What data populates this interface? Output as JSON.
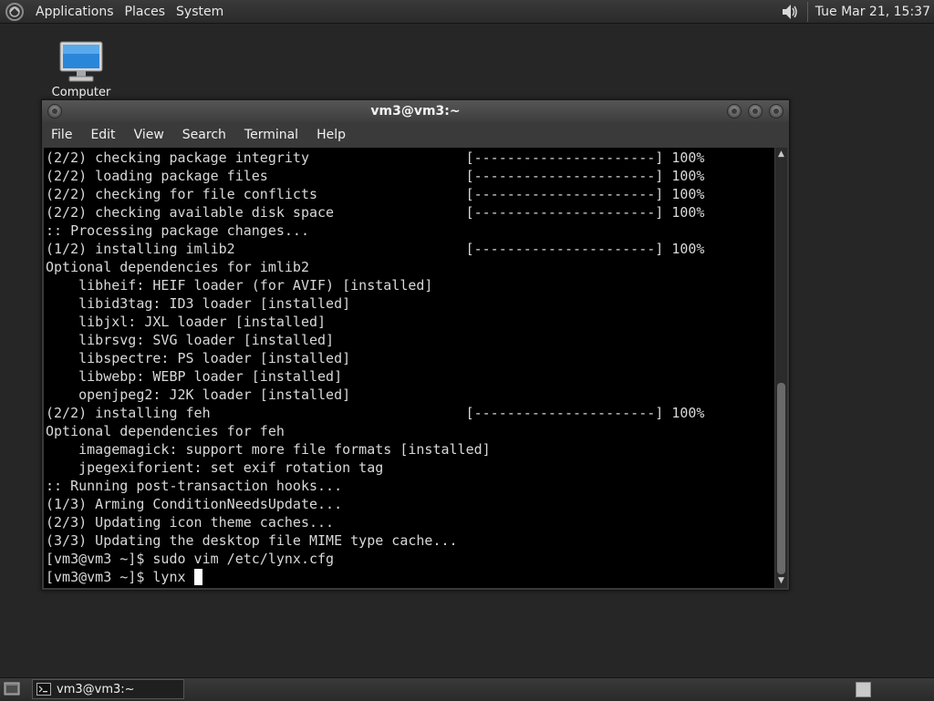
{
  "top_panel": {
    "menus": [
      "Applications",
      "Places",
      "System"
    ],
    "clock": "Tue Mar 21, 15:37"
  },
  "desktop": {
    "icons": [
      {
        "label": "Computer",
        "icon": "computer-icon"
      }
    ]
  },
  "terminal": {
    "title": "vm3@vm3:~",
    "menu": [
      "File",
      "Edit",
      "View",
      "Search",
      "Terminal",
      "Help"
    ],
    "lines": [
      "(2/2) checking package integrity                   [----------------------] 100%",
      "(2/2) loading package files                        [----------------------] 100%",
      "(2/2) checking for file conflicts                  [----------------------] 100%",
      "(2/2) checking available disk space                [----------------------] 100%",
      ":: Processing package changes...",
      "(1/2) installing imlib2                            [----------------------] 100%",
      "Optional dependencies for imlib2",
      "    libheif: HEIF loader (for AVIF) [installed]",
      "    libid3tag: ID3 loader [installed]",
      "    libjxl: JXL loader [installed]",
      "    librsvg: SVG loader [installed]",
      "    libspectre: PS loader [installed]",
      "    libwebp: WEBP loader [installed]",
      "    openjpeg2: J2K loader [installed]",
      "(2/2) installing feh                               [----------------------] 100%",
      "Optional dependencies for feh",
      "    imagemagick: support more file formats [installed]",
      "    jpegexiforient: set exif rotation tag",
      ":: Running post-transaction hooks...",
      "(1/3) Arming ConditionNeedsUpdate...",
      "(2/3) Updating icon theme caches...",
      "(3/3) Updating the desktop file MIME type cache...",
      "[vm3@vm3 ~]$ sudo vim /etc/lynx.cfg"
    ],
    "prompt": "[vm3@vm3 ~]$ lynx "
  },
  "bottom_panel": {
    "tasks": [
      {
        "label": "vm3@vm3:~",
        "icon": "terminal-icon"
      }
    ]
  },
  "colors": {
    "panel": "#2e2e2e",
    "terminal_bg": "#000000",
    "terminal_fg": "#d8d8d8"
  }
}
